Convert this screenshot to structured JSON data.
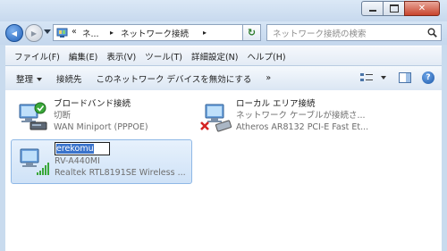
{
  "window": {
    "controls": {
      "minimize": "—",
      "maximize": "☐",
      "close": "✕"
    }
  },
  "address": {
    "overflow": "«",
    "segment1": "ネ...",
    "separator1": "▸",
    "segment2": "ネットワーク接続",
    "separator2": "▸",
    "back_glyph": "◀",
    "forward_glyph": "▶",
    "refresh_glyph": "↻"
  },
  "search": {
    "placeholder": "ネットワーク接続の検索"
  },
  "menu": {
    "items": [
      "ファイル(F)",
      "編集(E)",
      "表示(V)",
      "ツール(T)",
      "詳細設定(N)",
      "ヘルプ(H)"
    ]
  },
  "commands": {
    "organize": "整理",
    "connect": "接続先",
    "disable": "このネットワーク デバイスを無効にする",
    "more": "»",
    "help_glyph": "?"
  },
  "connections": [
    {
      "name": "ブロードバンド接続",
      "status": "切断",
      "device": "WAN Miniport (PPPOE)"
    },
    {
      "name": "ローカル エリア接続",
      "status": "ネットワーク ケーブルが接続さ...",
      "device": "Atheros AR8132 PCI-E Fast Et..."
    },
    {
      "name": "erekomu",
      "status": "RV-A440MI",
      "device": "Realtek RTL8191SE Wireless ..."
    }
  ],
  "colors": {
    "accent": "#3a73cb",
    "selection_bg": "#cfe2f7",
    "status_ok": "#3aa83a",
    "status_error": "#d42424"
  },
  "icons": {
    "back": "back-arrow-icon",
    "forward": "forward-arrow-icon",
    "search": "search-icon",
    "refresh": "refresh-icon",
    "help": "help-icon",
    "view": "view-options-icon",
    "preview_pane": "preview-pane-icon"
  }
}
